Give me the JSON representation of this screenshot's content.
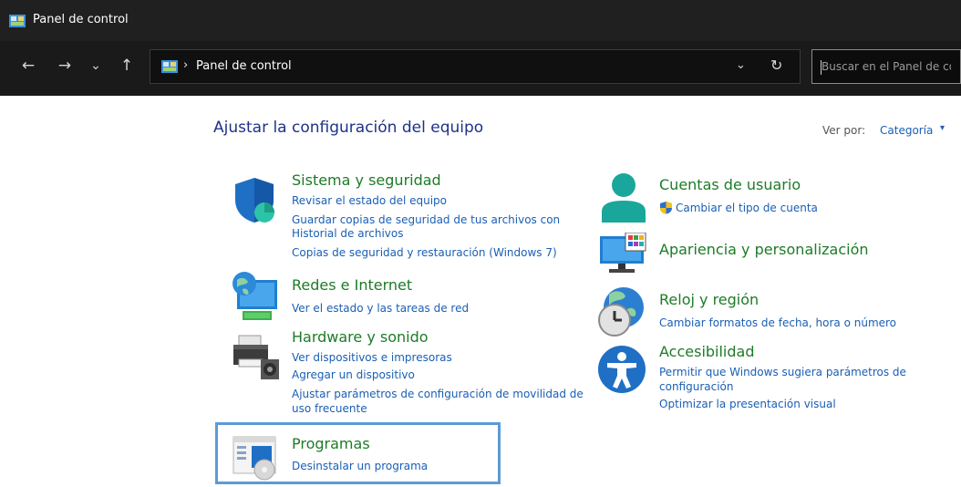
{
  "window": {
    "title": "Panel de control"
  },
  "nav": {
    "back": "←",
    "forward": "→",
    "recent": "⌄",
    "up": "↑",
    "separator": "›",
    "address": "Panel de control",
    "dropdown": "⌄",
    "refresh": "↻",
    "search_placeholder": "Buscar en el Panel de control"
  },
  "main": {
    "title": "Ajustar la configuración del equipo",
    "view_label": "Ver por:",
    "view_value": "Categoría",
    "view_caret": "▾"
  },
  "categories": {
    "system": {
      "title": "Sistema y seguridad",
      "links": [
        "Revisar el estado del equipo",
        "Guardar copias de seguridad de tus archivos con",
        "Historial de archivos",
        "Copias de seguridad y restauración (Windows 7)"
      ]
    },
    "network": {
      "title": "Redes e Internet",
      "links": [
        "Ver el estado y las tareas de red"
      ]
    },
    "hardware": {
      "title": "Hardware y sonido",
      "links": [
        "Ver dispositivos e impresoras",
        "Agregar un dispositivo",
        "Ajustar parámetros de configuración de movilidad de",
        "uso frecuente"
      ]
    },
    "programs": {
      "title": "Programas",
      "links": [
        "Desinstalar un programa"
      ]
    },
    "accounts": {
      "title": "Cuentas de usuario",
      "links": [
        "Cambiar el tipo de cuenta"
      ]
    },
    "appearance": {
      "title": "Apariencia y personalización",
      "links": []
    },
    "clock": {
      "title": "Reloj y región",
      "links": [
        "Cambiar formatos de fecha, hora o número"
      ]
    },
    "accessibility": {
      "title": "Accesibilidad",
      "links": [
        "Permitir que Windows sugiera parámetros de",
        "configuración",
        "Optimizar la presentación visual"
      ]
    }
  },
  "colors": {
    "heading": "#1d7b27",
    "link": "#1a5fb4",
    "title": "#1e3287",
    "highlight": "#5b9bd5"
  }
}
